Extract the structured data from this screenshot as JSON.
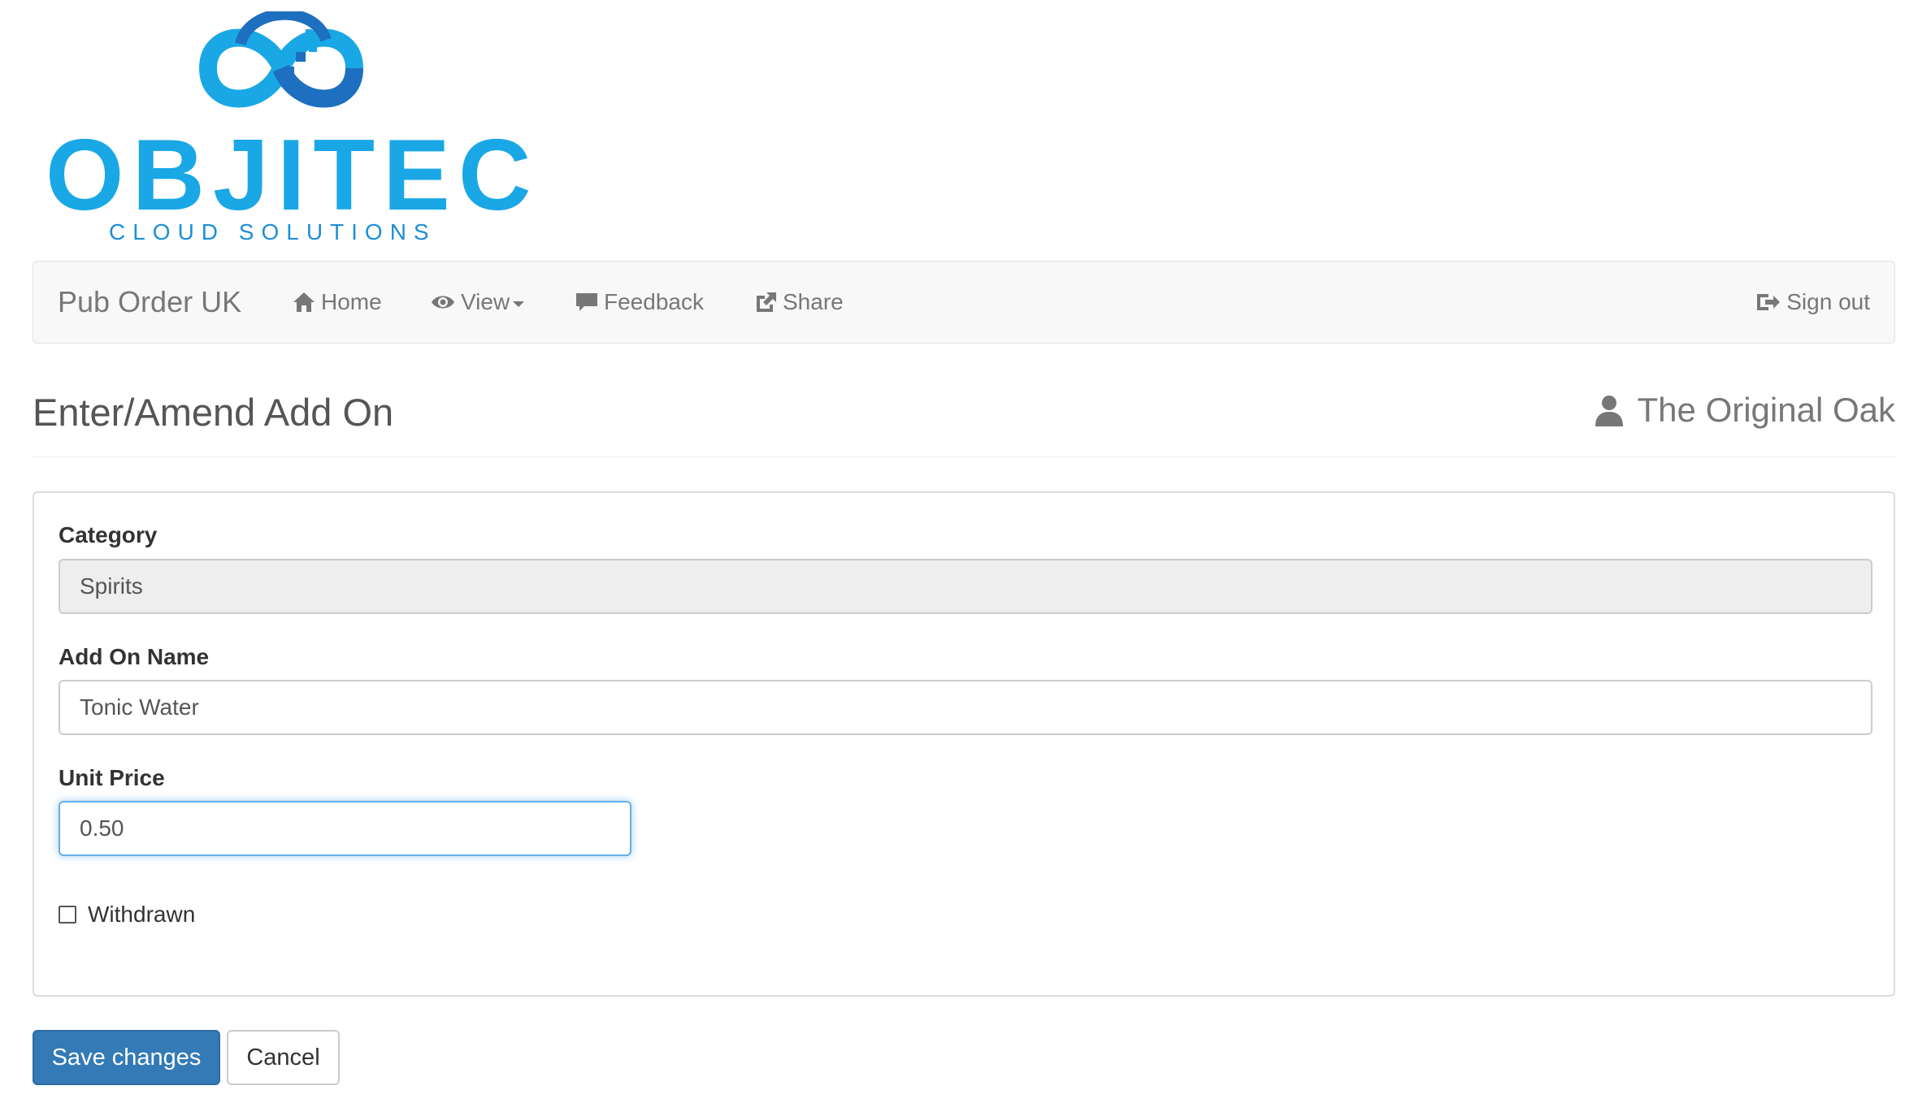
{
  "logo": {
    "wordmark": "OBJITEC",
    "tagline": "CLOUD SOLUTIONS",
    "colors": {
      "primary": "#1aa7e6",
      "dark": "#1e6fbf"
    }
  },
  "navbar": {
    "brand": "Pub Order UK",
    "items": [
      {
        "label": "Home",
        "icon": "home-icon"
      },
      {
        "label": "View",
        "icon": "eye-icon",
        "dropdown": true
      },
      {
        "label": "Feedback",
        "icon": "comment-icon"
      },
      {
        "label": "Share",
        "icon": "share-icon"
      }
    ],
    "signout": {
      "label": "Sign out",
      "icon": "sign-out-icon"
    }
  },
  "header": {
    "title": "Enter/Amend Add On",
    "venue": "The Original Oak",
    "venue_icon": "user-icon"
  },
  "form": {
    "category": {
      "label": "Category",
      "value": "Spirits",
      "readonly": true
    },
    "addon_name": {
      "label": "Add On Name",
      "value": "Tonic Water"
    },
    "unit_price": {
      "label": "Unit Price",
      "value": "0.50",
      "focused": true
    },
    "withdrawn": {
      "label": "Withdrawn",
      "checked": false
    }
  },
  "actions": {
    "save_label": "Save changes",
    "cancel_label": "Cancel"
  },
  "colors": {
    "primary_button": "#337ab7",
    "focus_border": "#66afe9",
    "navbar_bg": "#f8f8f8"
  }
}
